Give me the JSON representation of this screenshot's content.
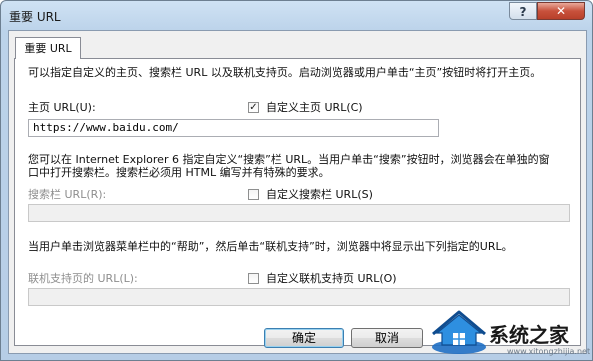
{
  "window": {
    "title": "重要 URL",
    "help_glyph": "?",
    "close_glyph": "✕"
  },
  "tab": {
    "label": "重要 URL"
  },
  "home": {
    "description": "可以指定自定义的主页、搜索栏 URL 以及联机支持页。启动浏览器或用户单击“主页”按钮时将打开主页。",
    "label": "主页 URL(U):",
    "checkbox_label": "自定义主页 URL(C)",
    "checked": true,
    "value": "https://www.baidu.com/"
  },
  "search": {
    "description": "您可以在 Internet Explorer 6 指定自定义“搜索”栏 URL。当用户单击“搜索”按钮时，浏览器会在单独的窗口中打开搜索栏。搜索栏必须用 HTML 编写并有特殊的要求。",
    "label": "搜索栏 URL(R):",
    "checkbox_label": "自定义搜索栏 URL(S)",
    "checked": false,
    "value": ""
  },
  "support": {
    "description": "当用户单击浏览器菜单栏中的“帮助”，然后单击“联机支持”时，浏览器中将显示出下列指定的URL。",
    "label": "联机支持页的 URL(L):",
    "checkbox_label": "自定义联机支持页 URL(O)",
    "checked": false,
    "value": ""
  },
  "buttons": {
    "ok": "确定",
    "cancel": "取消"
  },
  "watermark": {
    "text": "系统之家",
    "url": "www.xitongzhijia.net"
  }
}
